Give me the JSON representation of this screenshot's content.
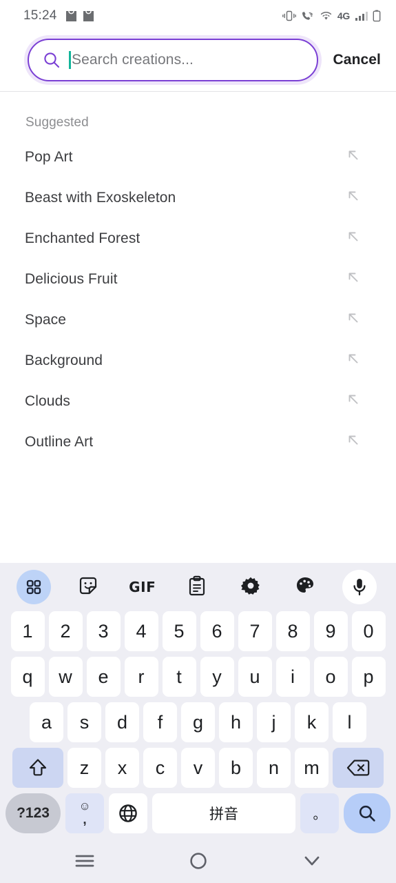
{
  "status_bar": {
    "time": "15:24",
    "notification_icons": [
      "shopping-bag-icon",
      "shopping-bag-icon"
    ],
    "network_label": "4G",
    "right_icons": [
      "vibrate-icon",
      "wifi-calling-icon",
      "wifi-icon",
      "signal-bars-icon",
      "battery-icon"
    ]
  },
  "search": {
    "placeholder": "Search creations...",
    "value": "",
    "cancel_label": "Cancel",
    "icon": "search-icon",
    "accent_color": "#7a3fd4",
    "caret_color": "#13b59a"
  },
  "suggestions": {
    "title": "Suggested",
    "items": [
      {
        "label": "Pop Art",
        "action_icon": "arrow-up-left-icon"
      },
      {
        "label": "Beast with Exoskeleton",
        "action_icon": "arrow-up-left-icon"
      },
      {
        "label": "Enchanted Forest",
        "action_icon": "arrow-up-left-icon"
      },
      {
        "label": "Delicious Fruit",
        "action_icon": "arrow-up-left-icon"
      },
      {
        "label": "Space",
        "action_icon": "arrow-up-left-icon"
      },
      {
        "label": "Background",
        "action_icon": "arrow-up-left-icon"
      },
      {
        "label": "Clouds",
        "action_icon": "arrow-up-left-icon"
      },
      {
        "label": "Outline Art",
        "action_icon": "arrow-up-left-icon"
      }
    ]
  },
  "keyboard": {
    "toolbar": [
      {
        "name": "apps-grid-icon",
        "label": "",
        "active": true
      },
      {
        "name": "sticker-icon",
        "label": ""
      },
      {
        "name": "gif-icon",
        "label": "GIF"
      },
      {
        "name": "clipboard-icon",
        "label": ""
      },
      {
        "name": "settings-gear-icon",
        "label": ""
      },
      {
        "name": "palette-icon",
        "label": ""
      },
      {
        "name": "microphone-icon",
        "label": ""
      }
    ],
    "row_numbers": [
      "1",
      "2",
      "3",
      "4",
      "5",
      "6",
      "7",
      "8",
      "9",
      "0"
    ],
    "row_q": [
      "q",
      "w",
      "e",
      "r",
      "t",
      "y",
      "u",
      "i",
      "o",
      "p"
    ],
    "row_a": [
      "a",
      "s",
      "d",
      "f",
      "g",
      "h",
      "j",
      "k",
      "l"
    ],
    "row_z": [
      "z",
      "x",
      "c",
      "v",
      "b",
      "n",
      "m"
    ],
    "shift_icon": "shift-up-arrow-icon",
    "backspace_icon": "backspace-icon",
    "symbols_key": "?123",
    "emoji_key_top": "☺",
    "emoji_key_bottom": ",",
    "language_icon": "globe-icon",
    "space_label": "拼音",
    "period_key": "。",
    "enter_icon": "search-icon",
    "key_bg": "#ffffff",
    "mod_key_bg": "#ccd6f2",
    "enter_key_bg": "#b6cdf8",
    "keyboard_bg": "#eeeef4"
  },
  "nav_bar": {
    "recents_icon": "menu-lines-icon",
    "home_icon": "circle-icon",
    "back_icon": "chevron-down-icon"
  }
}
